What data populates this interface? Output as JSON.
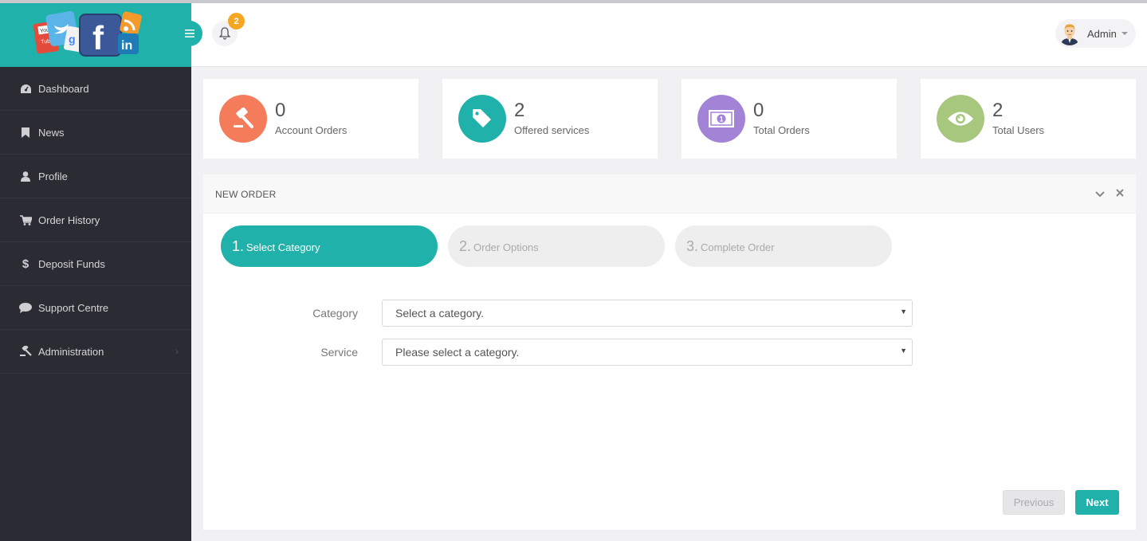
{
  "header": {
    "notification_count": "2",
    "user_name": "Admin"
  },
  "sidebar": {
    "items": [
      {
        "label": "Dashboard",
        "icon": "dashboard-icon"
      },
      {
        "label": "News",
        "icon": "bookmark-icon"
      },
      {
        "label": "Profile",
        "icon": "user-icon"
      },
      {
        "label": "Order History",
        "icon": "cart-icon"
      },
      {
        "label": "Deposit Funds",
        "icon": "dollar-icon"
      },
      {
        "label": "Support Centre",
        "icon": "chat-icon"
      },
      {
        "label": "Administration",
        "icon": "gavel-icon"
      }
    ]
  },
  "stats": [
    {
      "value": "0",
      "label": "Account Orders",
      "icon": "gavel-icon",
      "color": "#f47c5a"
    },
    {
      "value": "2",
      "label": "Offered services",
      "icon": "tag-icon",
      "color": "#20b2aa"
    },
    {
      "value": "0",
      "label": "Total Orders",
      "icon": "money-icon",
      "color": "#a383d6"
    },
    {
      "value": "2",
      "label": "Total Users",
      "icon": "eye-icon",
      "color": "#a7c77e"
    }
  ],
  "panel": {
    "title": "NEW ORDER",
    "steps": [
      {
        "num": "1.",
        "label": "Select Category"
      },
      {
        "num": "2.",
        "label": "Order Options"
      },
      {
        "num": "3.",
        "label": "Complete Order"
      }
    ],
    "category_label": "Category",
    "category_value": "Select a category.",
    "service_label": "Service",
    "service_value": "Please select a category.",
    "previous_label": "Previous",
    "next_label": "Next"
  },
  "colors": {
    "accent": "#20b2aa",
    "sidebar_bg": "#2b2b33",
    "badge": "#f5a623"
  }
}
